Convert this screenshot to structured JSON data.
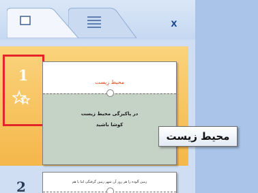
{
  "tabs": [
    {
      "icon": "slides-view-icon",
      "active": true
    },
    {
      "icon": "outline-view-icon",
      "active": false
    }
  ],
  "close_label": "x",
  "slides": [
    {
      "number": "1",
      "selected": true,
      "animation_icon": "animation-star-icon",
      "title": "محیط زیست",
      "subtitle_line1": "در پاکیزگی محیط زیست",
      "subtitle_line2": "کوشا باشید"
    },
    {
      "number": "2",
      "selected": false,
      "title": "زمین آلوده را هر روز آن شهر زمین گرفتگی اما با هم"
    }
  ],
  "tooltip": "محیط زیست",
  "colors": {
    "selection": "#f4b74a",
    "highlight_box": "#e3252a",
    "title_text": "#e04b1b"
  }
}
